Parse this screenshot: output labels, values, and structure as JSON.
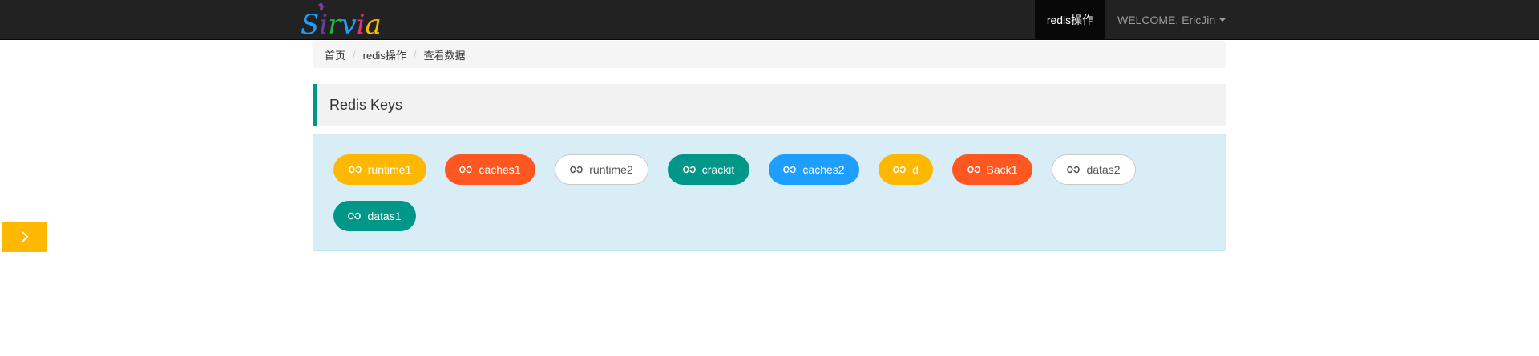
{
  "navbar": {
    "logo_text": "Sirvia",
    "active_item": "redis操作",
    "user_menu": "WELCOME, EricJin"
  },
  "breadcrumb": [
    "首页",
    "redis操作",
    "查看数据"
  ],
  "section": {
    "title": "Redis Keys"
  },
  "keys": [
    {
      "label": "runtime1",
      "style": "yellow",
      "icon": "infinity-link-icon"
    },
    {
      "label": "caches1",
      "style": "orange",
      "icon": "infinity-link-icon"
    },
    {
      "label": "runtime2",
      "style": "white",
      "icon": "infinity-link-icon"
    },
    {
      "label": "crackit",
      "style": "teal",
      "icon": "infinity-link-icon"
    },
    {
      "label": "caches2",
      "style": "blue",
      "icon": "infinity-link-icon"
    },
    {
      "label": "d",
      "style": "yellow",
      "icon": "infinity-link-icon"
    },
    {
      "label": "Back1",
      "style": "orange",
      "icon": "infinity-link-icon"
    },
    {
      "label": "datas2",
      "style": "white",
      "icon": "infinity-link-icon"
    },
    {
      "label": "datas1",
      "style": "teal",
      "icon": "infinity-link-icon"
    }
  ],
  "side_toggle": {
    "icon": "chevron-right-icon"
  },
  "colors": {
    "navbar_bg": "#222222",
    "accent_teal": "#009688",
    "yellow": "#FFB800",
    "orange": "#FF5722",
    "blue": "#1E9FFF",
    "panel_bg": "#d9edf7"
  }
}
